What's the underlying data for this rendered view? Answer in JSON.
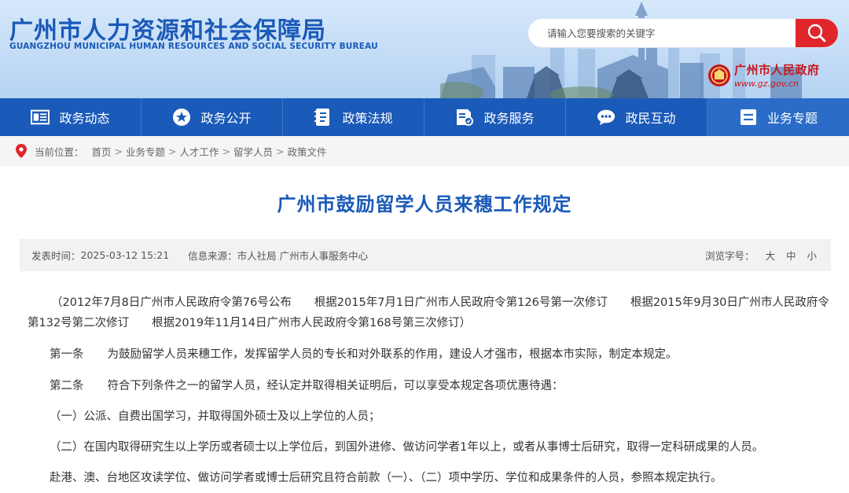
{
  "header": {
    "title": "广州市人力资源和社会保障局",
    "subtitle": "GUANGZHOU MUNICIPAL HUMAN RESOURCES AND SOCIAL SECURITY BUREAU",
    "search_placeholder": "请输入您要搜索的关键字",
    "search_icon": "magnifier-icon",
    "gov_name": "广州市人民政府",
    "gov_url": "www.gz.gov.cn"
  },
  "nav": {
    "items": [
      {
        "label": "政务动态",
        "icon": "news-icon"
      },
      {
        "label": "政务公开",
        "icon": "star-icon"
      },
      {
        "label": "政策法规",
        "icon": "book-icon"
      },
      {
        "label": "政务服务",
        "icon": "service-icon"
      },
      {
        "label": "政民互动",
        "icon": "chat-icon"
      },
      {
        "label": "业务专题",
        "icon": "topic-icon"
      }
    ],
    "active_index": 5
  },
  "breadcrumb": {
    "prefix": "当前位置：",
    "items": [
      "首页",
      "业务专题",
      "人才工作",
      "留学人员",
      "政策文件"
    ],
    "separator": ">"
  },
  "article": {
    "title": "广州市鼓励留学人员来穗工作规定",
    "meta": {
      "publish_label": "发表时间：",
      "publish_value": "2025-03-12 15:21",
      "source_label": "信息来源：",
      "source_value": "市人社局 广州市人事服务中心",
      "font_size_label": "浏览字号：",
      "font_sizes": [
        "大",
        "中",
        "小"
      ]
    },
    "preamble": "（2012年7月8日广州市人民政府令第76号公布　　根据2015年7月1日广州市人民政府令第126号第一次修订　　根据2015年9月30日广州市人民政府令第132号第二次修订　　根据2019年11月14日广州市人民政府令第168号第三次修订）",
    "art1_no": "第一条",
    "art1_text": "为鼓励留学人员来穗工作，发挥留学人员的专长和对外联系的作用，建设人才强市，根据本市实际，制定本规定。",
    "art2_no": "第二条",
    "art2_text": "符合下列条件之一的留学人员，经认定并取得相关证明后，可以享受本规定各项优惠待遇：",
    "item1": "（一）公派、自费出国学习，并取得国外硕士及以上学位的人员；",
    "item2": "（二）在国内取得研究生以上学历或者硕士以上学位后，到国外进修、做访问学者1年以上，或者从事博士后研究，取得一定科研成果的人员。",
    "item3": "赴港、澳、台地区攻读学位、做访问学者或博士后研究且符合前款（一）、（二）项中学历、学位和成果条件的人员，参照本规定执行。"
  },
  "colors": {
    "brand_blue": "#1a5ab8",
    "search_red": "#e0262b",
    "gov_red": "#c8161d"
  }
}
